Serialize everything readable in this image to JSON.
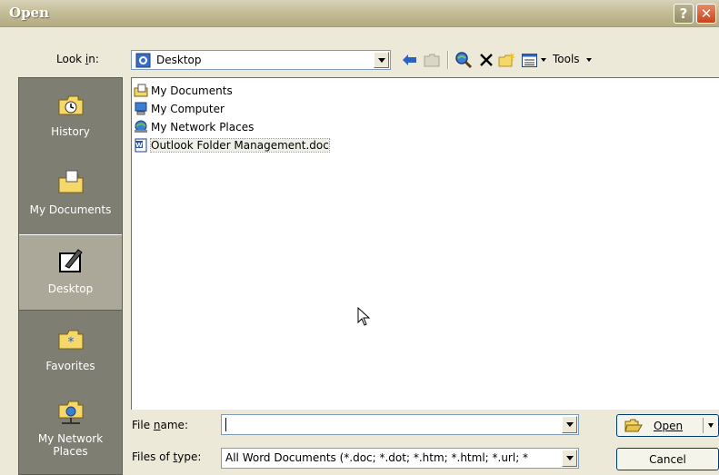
{
  "window": {
    "title": "Open"
  },
  "toolbar": {
    "look_in_label": "Look in:",
    "look_in_value": "Desktop",
    "tools_label": "Tools"
  },
  "places": [
    {
      "label": "History"
    },
    {
      "label": "My Documents"
    },
    {
      "label": "Desktop"
    },
    {
      "label": "Favorites"
    },
    {
      "label": "My Network Places"
    }
  ],
  "files": [
    {
      "name": "My Documents",
      "icon": "my-documents-icon"
    },
    {
      "name": "My Computer",
      "icon": "my-computer-icon"
    },
    {
      "name": "My Network Places",
      "icon": "network-places-icon"
    },
    {
      "name": "Outlook Folder Management.doc",
      "icon": "word-doc-icon"
    }
  ],
  "form": {
    "file_name_label": "File name:",
    "file_name_value": "",
    "files_of_type_label": "Files of type:",
    "files_of_type_value": "All Word Documents (*.doc; *.dot; *.htm; *.html; *.url; *",
    "open_label": "Open",
    "cancel_label": "Cancel"
  }
}
